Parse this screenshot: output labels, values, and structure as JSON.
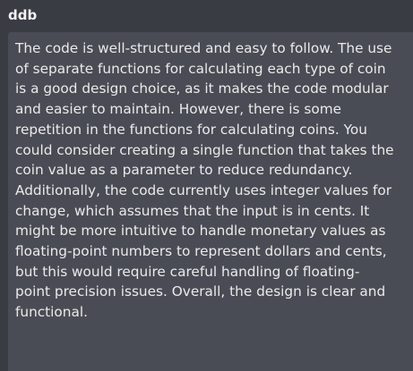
{
  "comment": {
    "author": "ddb",
    "text": "The code is well-structured and easy to follow. The use\nof separate functions for calculating each type of coin\nis a good design choice, as it makes the code modular\nand easier to maintain. However, there is some\nrepetition in the functions for calculating coins. You\ncould consider creating a single function that takes the\ncoin value as a parameter to reduce redundancy.\nAdditionally, the code currently uses integer values for\nchange, which assumes that the input is in cents. It\nmight be more intuitive to handle monetary values as\nfloating-point numbers to represent dollars and cents,\nbut this would require careful handling of floating-\npoint precision issues. Overall, the design is clear and\nfunctional."
  }
}
